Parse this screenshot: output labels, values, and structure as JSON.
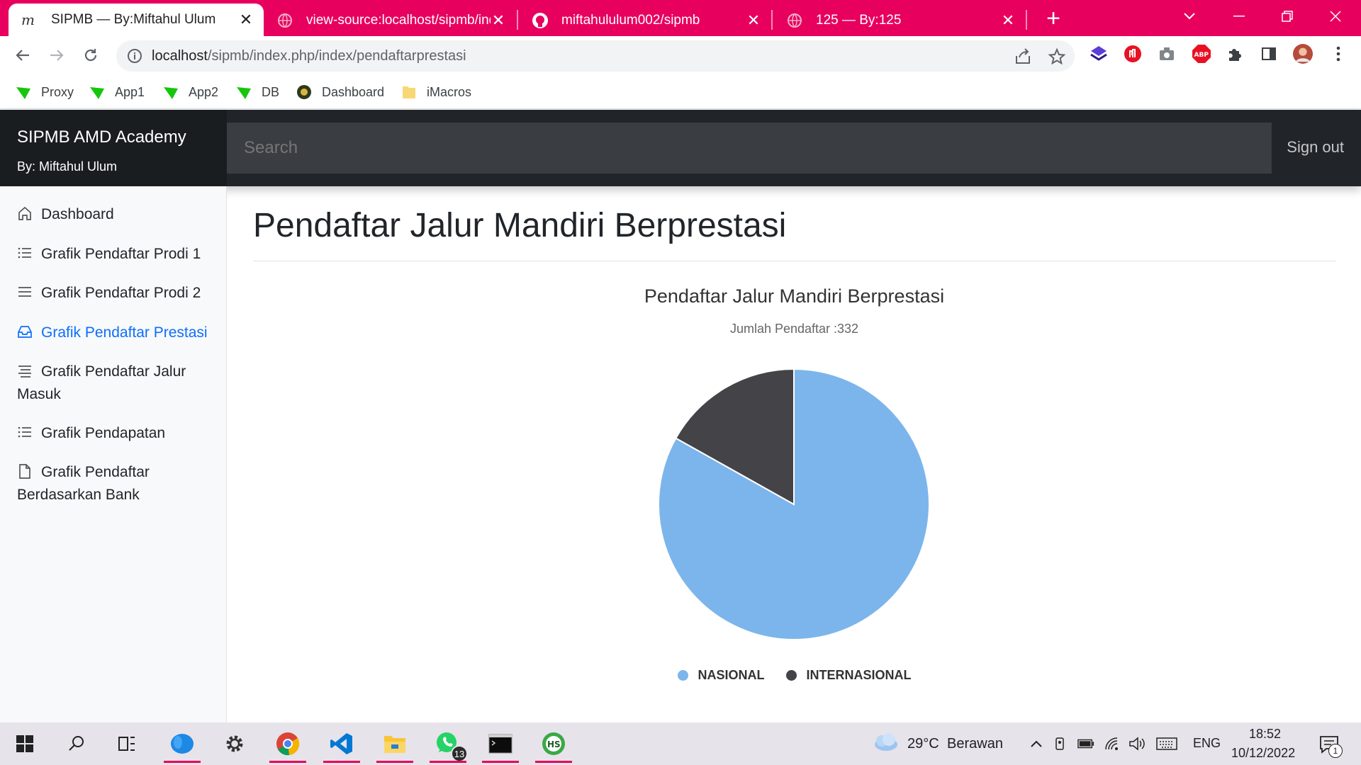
{
  "browser": {
    "tabs": [
      {
        "title": "SIPMB — By:Miftahul Ulum",
        "active": true
      },
      {
        "title": "view-source:localhost/sipmb/ind",
        "active": false
      },
      {
        "title": "miftahululum002/sipmb",
        "active": false
      },
      {
        "title": "125 — By:125",
        "active": false
      }
    ],
    "url_host": "localhost",
    "url_path": "/sipmb/index.php/index/pendaftarprestasi",
    "bookmarks": [
      "Proxy",
      "App1",
      "App2",
      "DB",
      "Dashboard",
      "iMacros"
    ]
  },
  "app": {
    "brand_title": "SIPMB AMD Academy",
    "brand_subtitle": "By: Miftahul Ulum",
    "search_placeholder": "Search",
    "signout_label": "Sign out"
  },
  "sidebar": {
    "items": [
      {
        "label": "Dashboard",
        "icon": "home-icon",
        "active": false
      },
      {
        "label": "Grafik Pendaftar Prodi 1",
        "icon": "list-icon",
        "active": false
      },
      {
        "label": "Grafik Pendaftar Prodi 2",
        "icon": "menu-icon",
        "active": false
      },
      {
        "label": "Grafik Pendaftar Prestasi",
        "icon": "inbox-icon",
        "active": true
      },
      {
        "label": "Grafik Pendaftar Jalur Masuk",
        "icon": "align-icon",
        "active": false
      },
      {
        "label": "Grafik Pendapatan",
        "icon": "list-icon",
        "active": false
      },
      {
        "label": "Grafik Pendaftar Berdasarkan Bank",
        "icon": "file-icon",
        "active": false
      }
    ]
  },
  "main": {
    "page_title": "Pendaftar Jalur Mandiri Berprestasi"
  },
  "chart_data": {
    "type": "pie",
    "title": "Pendaftar Jalur Mandiri Berprestasi",
    "subtitle": "Jumlah Pendaftar :332",
    "categories": [
      "NASIONAL",
      "INTERNASIONAL"
    ],
    "values": [
      276,
      56
    ],
    "colors": [
      "#7cb5ec",
      "#434348"
    ],
    "legend": "bottom-center"
  },
  "taskbar": {
    "weather_temp": "29°C",
    "weather_text": "Berawan",
    "language": "ENG",
    "time": "18:52",
    "date": "10/12/2022",
    "whatsapp_badge": "13",
    "notification_badge": "1"
  },
  "colors": {
    "tabstrip": "#e8005f",
    "active_link": "#0d6efd",
    "navbar": "#212529"
  }
}
